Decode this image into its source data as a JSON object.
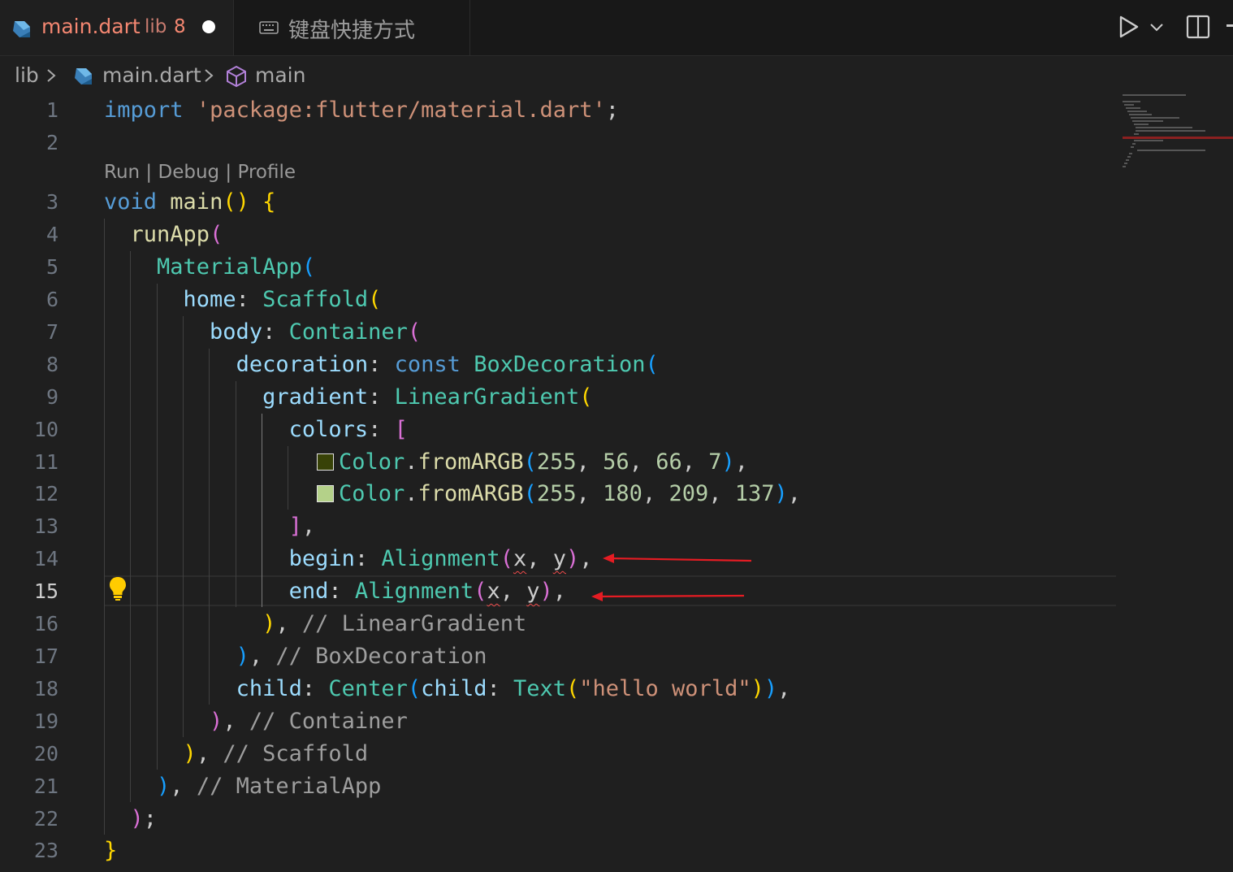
{
  "tabs": [
    {
      "title": "main.dart",
      "dir": "lib",
      "problems": "8",
      "dirty": true,
      "active": true,
      "icon": "dart-icon"
    },
    {
      "title": "键盘快捷方式",
      "active": false,
      "icon": "keyboard-icon"
    }
  ],
  "toolbar": {
    "run_icon": "play-icon",
    "run_dropdown_icon": "chevron-down-icon",
    "split_icon": "split-editor-icon"
  },
  "breadcrumb": {
    "folder": "lib",
    "file": "main.dart",
    "symbol": "main"
  },
  "codelens": {
    "run": "Run",
    "debug": "Debug",
    "profile": "Profile",
    "sep": " | "
  },
  "current_line": "15",
  "line_numbers": [
    "1",
    "2",
    "3",
    "4",
    "5",
    "6",
    "7",
    "8",
    "9",
    "10",
    "11",
    "12",
    "13",
    "14",
    "15",
    "16",
    "17",
    "18",
    "19",
    "20",
    "21",
    "22",
    "23"
  ],
  "code": {
    "l1": {
      "kw": "import",
      "str": "'package:flutter/material.dart'",
      "end": ";"
    },
    "l3": {
      "kw": "void",
      "name": "main",
      "parens": "()",
      "brace": "{"
    },
    "l4": {
      "fn": "runApp",
      "open": "("
    },
    "l5": {
      "cls": "MaterialApp",
      "open": "("
    },
    "l6": {
      "prop": "home",
      "colon": ": ",
      "cls": "Scaffold",
      "open": "("
    },
    "l7": {
      "prop": "body",
      "colon": ": ",
      "cls": "Container",
      "open": "("
    },
    "l8": {
      "prop": "decoration",
      "colon": ": ",
      "kw": "const",
      "cls": "BoxDecoration",
      "open": "("
    },
    "l9": {
      "prop": "gradient",
      "colon": ": ",
      "cls": "LinearGradient",
      "open": "("
    },
    "l10": {
      "prop": "colors",
      "colon": ": ",
      "open": "["
    },
    "l11": {
      "cls": "Color",
      "dot": ".",
      "fn": "fromARGB",
      "open": "(",
      "a": "255",
      "r": "56",
      "g": "66",
      "b": "7",
      "close": ")",
      "comma": ",",
      "swatch": "#384207"
    },
    "l12": {
      "cls": "Color",
      "dot": ".",
      "fn": "fromARGB",
      "open": "(",
      "a": "255",
      "r": "180",
      "g": "209",
      "b": "137",
      "close": ")",
      "comma": ",",
      "swatch": "#b4d189"
    },
    "l13": {
      "close": "]",
      "comma": ","
    },
    "l14": {
      "prop": "begin",
      "colon": ": ",
      "cls": "Alignment",
      "open": "(",
      "x": "x",
      "y": "y",
      "close": ")",
      "comma": ","
    },
    "l15": {
      "prop": "end",
      "colon": ": ",
      "cls": "Alignment",
      "open": "(",
      "x": "x",
      "y": "y",
      "close": ")",
      "comma": ","
    },
    "l16": {
      "close": ")",
      "comma": ",",
      "comment": "// LinearGradient"
    },
    "l17": {
      "close": ")",
      "comma": ",",
      "comment": "// BoxDecoration"
    },
    "l18": {
      "prop": "child",
      "colon": ": ",
      "cls": "Center",
      "open": "(",
      "prop2": "child",
      "cls2": "Text",
      "open2": "(",
      "str": "\"hello world\"",
      "close2": ")",
      "close": ")",
      "comma": ","
    },
    "l19": {
      "close": ")",
      "comma": ",",
      "comment": "// Container"
    },
    "l20": {
      "close": ")",
      "comma": ",",
      "comment": "// Scaffold"
    },
    "l21": {
      "close": ")",
      "comma": ",",
      "comment": "// MaterialApp"
    },
    "l22": {
      "close": ")",
      "end": ";"
    },
    "l23": {
      "brace": "}"
    }
  },
  "colors": {
    "error": "#f14c4c",
    "annotation_arrow": "#e51c23",
    "swatch_dark": "#384207",
    "swatch_light": "#b4d189"
  }
}
